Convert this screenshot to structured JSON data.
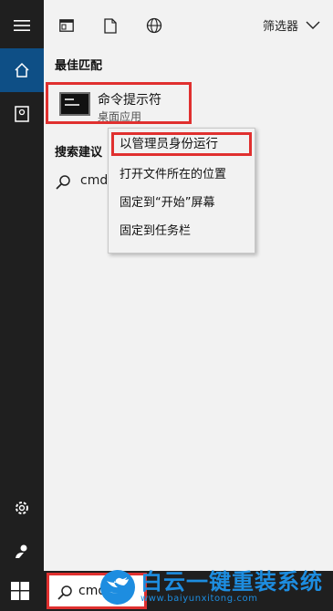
{
  "topbar": {
    "icons": [
      "apps-icon",
      "document-icon",
      "web-icon"
    ],
    "filter_label": "筛选器"
  },
  "sections": {
    "best_match": "最佳匹配",
    "search_suggestions": "搜索建议"
  },
  "best_match_item": {
    "title": "命令提示符",
    "subtitle": "桌面应用"
  },
  "suggestion": {
    "text": "cmd"
  },
  "context_menu": {
    "items": [
      "以管理员身份运行",
      "打开文件所在的位置",
      "固定到“开始”屏幕",
      "固定到任务栏"
    ]
  },
  "taskbar": {
    "search_text": "cmd"
  },
  "watermark": {
    "title": "白云一键重装系统",
    "url": "www.baiyunxitong.com"
  },
  "colors": {
    "highlight_border": "#e0302f",
    "rail": "#1f1f1f",
    "rail_active": "#0e4f86",
    "panel": "#f2f2f2",
    "watermark": "#1d8de0"
  }
}
